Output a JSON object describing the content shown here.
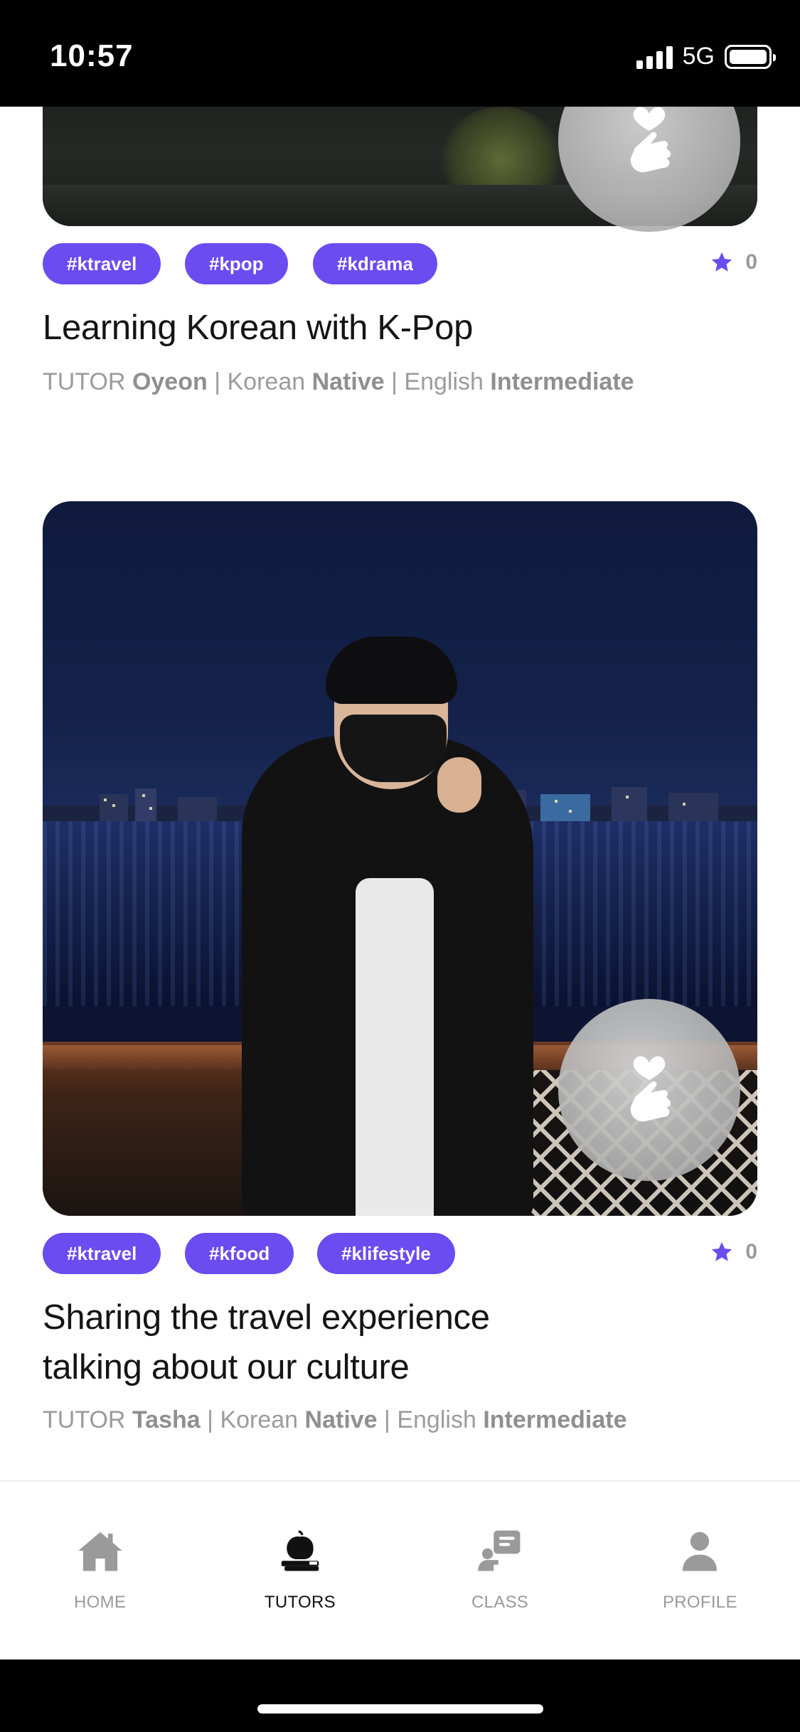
{
  "status_bar": {
    "time": "10:57",
    "network": "5G"
  },
  "cards": [
    {
      "tags": [
        "#ktravel",
        "#kpop",
        "#kdrama"
      ],
      "rating": "0",
      "title_lines": [
        "Learning Korean with K-Pop"
      ],
      "tutor_label": "TUTOR",
      "tutor_name": "Oyeon",
      "lang1_label": "Korean",
      "lang1_level": "Native",
      "lang2_label": "English",
      "lang2_level": "Intermediate"
    },
    {
      "tags": [
        "#ktravel",
        "#kfood",
        "#klifestyle"
      ],
      "rating": "0",
      "title_lines": [
        "Sharing the travel experience",
        "talking about our culture"
      ],
      "tutor_label": "TUTOR",
      "tutor_name": "Tasha",
      "lang1_label": "Korean",
      "lang1_level": "Native",
      "lang2_label": "English",
      "lang2_level": "Intermediate"
    }
  ],
  "separator": "|",
  "tabbar": {
    "items": [
      {
        "label": "HOME",
        "icon": "home-icon"
      },
      {
        "label": "TUTORS",
        "icon": "tutor-icon"
      },
      {
        "label": "CLASS",
        "icon": "class-icon"
      },
      {
        "label": "PROFILE",
        "icon": "profile-icon"
      }
    ],
    "active": "TUTORS"
  },
  "colors": {
    "accent": "#6a4cf0",
    "muted": "#9b9b9b",
    "text": "#141414"
  }
}
